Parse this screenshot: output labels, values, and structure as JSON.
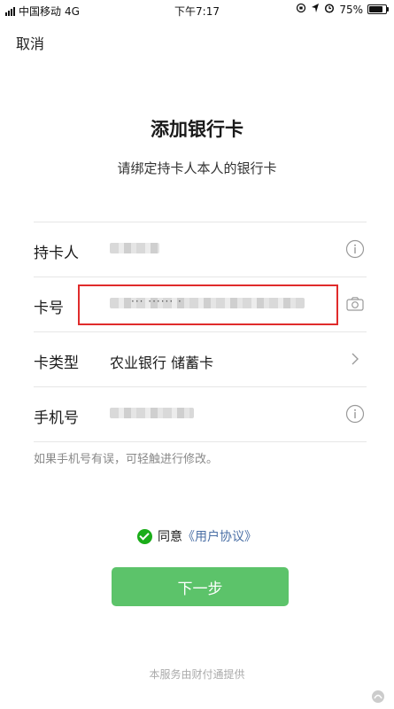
{
  "status_bar": {
    "carrier": "中国移动",
    "network": "4G",
    "time": "下午7:17",
    "battery": "75%",
    "battery_level": 0.75
  },
  "nav": {
    "cancel": "取消"
  },
  "header": {
    "title": "添加银行卡",
    "subtitle": "请绑定持卡人本人的银行卡"
  },
  "form": {
    "cardholder": {
      "label": "持卡人"
    },
    "card_number": {
      "label": "卡号",
      "masked": "··· ······ ·"
    },
    "card_type": {
      "label": "卡类型",
      "value": "农业银行 储蓄卡"
    },
    "phone": {
      "label": "手机号"
    }
  },
  "hint": "如果手机号有误，可轻触进行修改。",
  "agreement": {
    "prefix": "同意",
    "link": "《用户协议》"
  },
  "next_button": "下一步",
  "footer": "本服务由财付通提供",
  "colors": {
    "accent": "#1aad19",
    "button": "#5cc36a",
    "link": "#4a6fa5",
    "highlight": "#e02b2b"
  }
}
